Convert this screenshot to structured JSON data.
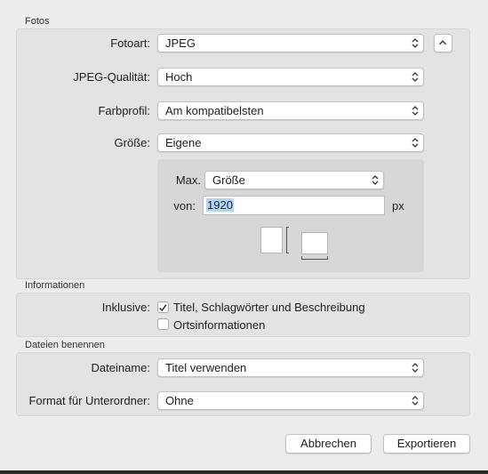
{
  "photos": {
    "section_title": "Fotos",
    "type_label": "Fotoart:",
    "type_value": "JPEG",
    "quality_label": "JPEG-Qualität:",
    "quality_value": "Hoch",
    "profile_label": "Farbprofil:",
    "profile_value": "Am kompatibelsten",
    "size_label": "Größe:",
    "size_value": "Eigene",
    "max_label": "Max.",
    "max_value": "Größe",
    "from_label": "von:",
    "from_value": "1920",
    "unit": "px"
  },
  "info": {
    "section_title": "Informationen",
    "include_label": "Inklusive:",
    "options": [
      {
        "label": "Titel, Schlagwörter und Beschreibung",
        "checked": true
      },
      {
        "label": "Ortsinformationen",
        "checked": false
      }
    ]
  },
  "naming": {
    "section_title": "Dateien benennen",
    "filename_label": "Dateiname:",
    "filename_value": "Titel verwenden",
    "subfolder_label": "Format für Unterordner:",
    "subfolder_value": "Ohne"
  },
  "buttons": {
    "cancel": "Abbrechen",
    "export": "Exportieren"
  },
  "icons": {
    "popup_arrows": "up-down-chevron-icon",
    "collapse": "chevron-up-icon",
    "checkmark": "checkmark-icon",
    "portrait": "portrait-orientation-icon",
    "landscape": "landscape-orientation-icon"
  }
}
